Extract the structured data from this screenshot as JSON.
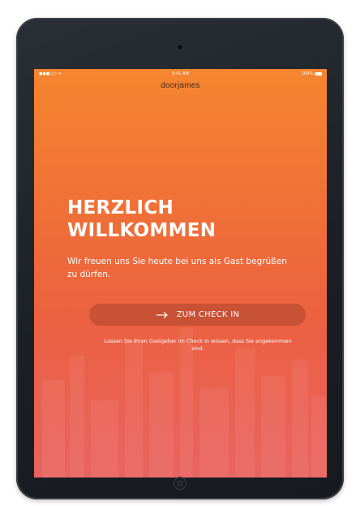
{
  "status_bar": {
    "carrier": "●●●○○ ᯤ",
    "time": "9:41 AM",
    "battery": "100%"
  },
  "app": {
    "brand": "doorjames"
  },
  "welcome": {
    "headline_line1": "HERZLICH",
    "headline_line2": "WILLKOMMEN",
    "subtitle": "Wir freuen uns Sie heute bei uns als Gast begrüßen zu dürfen."
  },
  "checkin": {
    "button_label": "ZUM CHECK IN",
    "hint": "Lassen Sie Ihren Gastgeber im Check in wissen, dass Sie angekommen sind."
  },
  "icons": {
    "checkin_arrow": "arrow-right-icon",
    "camera": "camera-icon",
    "home": "home-button-icon"
  },
  "colors": {
    "gradient_top": "#f5862f",
    "gradient_bottom": "#e64f4b",
    "button_bg": "#963c28",
    "bezel": "#1c2026"
  }
}
